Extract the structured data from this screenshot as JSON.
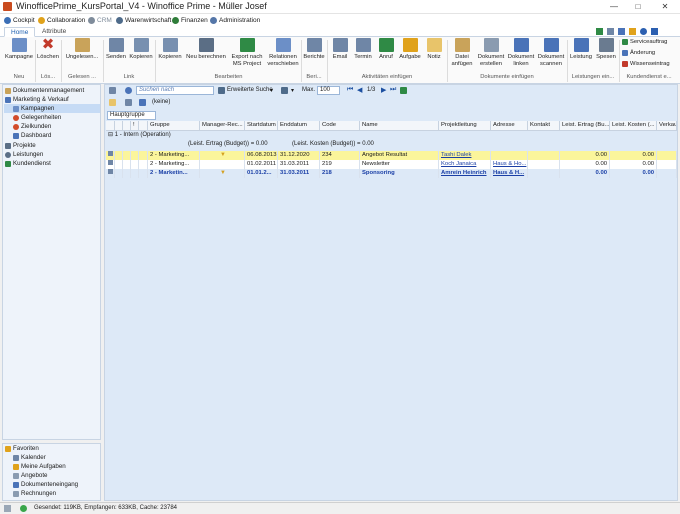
{
  "window": {
    "title": "WinofficePrime_KursPortal_V4 - Winoffice Prime - Müller Josef"
  },
  "modules": [
    {
      "label": "Cockpit",
      "color": "#3b6fb6"
    },
    {
      "label": "Collaboration",
      "color": "#e0a21b"
    },
    {
      "label": "CRM",
      "color": "#7f8c9b"
    },
    {
      "label": "Warenwirtschaft",
      "color": "#4e6b8a"
    },
    {
      "label": "Finanzen",
      "color": "#2f7d3a"
    },
    {
      "label": "Administration",
      "color": "#5576a8"
    }
  ],
  "ribbon_tabs": [
    "Home",
    "Attribute"
  ],
  "ribbon": {
    "buttons": [
      {
        "label": "Kampagne",
        "color": "#6c8fc7"
      },
      {
        "label": "Löschen",
        "color": "#c23a2b"
      },
      {
        "label": "Ungelesen...",
        "color": "#c9a35a"
      },
      {
        "label": "Senden",
        "color": "#6f86a6"
      },
      {
        "label": "Kopieren",
        "color": "#7890b0"
      },
      {
        "label": "Kopieren",
        "color": "#7890b0"
      },
      {
        "label": "Neu berechnen",
        "color": "#5b6e85"
      },
      {
        "label": "Export nach\nMS Project",
        "color": "#2f8a45"
      },
      {
        "label": "Relationen\nverschieben",
        "color": "#6c8fc7"
      },
      {
        "label": "Berichte",
        "color": "#6f86a6"
      },
      {
        "label": "Email",
        "color": "#6f86a6"
      },
      {
        "label": "Termin",
        "color": "#6f86a6"
      },
      {
        "label": "Anruf",
        "color": "#2f8a45"
      },
      {
        "label": "Aufgabe",
        "color": "#e0a21b"
      },
      {
        "label": "Notiz",
        "color": "#e8c46a"
      },
      {
        "label": "Datei\nanfügen",
        "color": "#c9a35a"
      },
      {
        "label": "Dokument\nerstellen",
        "color": "#8a9bb0"
      },
      {
        "label": "Dokument\nlinken",
        "color": "#4a73b8"
      },
      {
        "label": "Dokument\nscannen",
        "color": "#4a73b8"
      },
      {
        "label": "Leistung",
        "color": "#4a73b8"
      },
      {
        "label": "Spesen",
        "color": "#6a7b90"
      }
    ],
    "groups": [
      "Neu",
      "Lös...",
      "Gelesen ...",
      "Link",
      "Bearbeiten",
      "Beri...",
      "Aktivitäten einfügen",
      "Dokumente einfügen",
      "Leistungen ein...",
      "Kundendienst e..."
    ],
    "small_buttons": [
      "Serviceauftrag",
      "Änderung",
      "Wissenseintrag"
    ]
  },
  "nav": {
    "items": [
      {
        "label": "Dokumentenmanagement"
      },
      {
        "label": "Marketing & Verkauf"
      },
      {
        "label": "Kampagnen"
      },
      {
        "label": "Gelegenheiten"
      },
      {
        "label": "Zielkunden"
      },
      {
        "label": "Dashboard"
      },
      {
        "label": "Projekte"
      },
      {
        "label": "Leistungen"
      },
      {
        "label": "Kundendienst"
      }
    ],
    "favorites_title": "Favoriten",
    "favorites": [
      "Kalender",
      "Meine Aufgaben",
      "Angebote",
      "Dokumenteneingang",
      "Rechnungen"
    ]
  },
  "toolbar": {
    "search_placeholder": "Suchen nach",
    "advanced_search": "Erweiterte Suche",
    "max_label": "Max.",
    "max_value": "100",
    "pager": "1/3",
    "filter_value": "(keine)",
    "group_by": "Hauptgruppe"
  },
  "grid": {
    "columns": [
      "Gruppe",
      "Manager-Rec...",
      "Startdatum",
      "Enddatum",
      "Code",
      "Name",
      "Projektleitung",
      "Adresse",
      "Kontakt",
      "Leist. Ertrag (Bu...",
      "Leist. Kosten (...",
      "Verkau"
    ],
    "group_row": "1 - Intern (Operation)",
    "sum_ertrag": "(Leist. Ertrag (Budget)) = 0.00",
    "sum_kosten": "(Leist. Kosten (Budget)) = 0.00",
    "rows": [
      {
        "gruppe": "2 - Marketing...",
        "start": "06.08.2013",
        "end": "31.12.2020",
        "code": "234",
        "name": "Angebot Resultat",
        "pl": "Tashi Dalek",
        "adresse": "",
        "ertrag": "0.00",
        "kosten": "0.00",
        "highlight": "#fbf59b",
        "bold": false
      },
      {
        "gruppe": "2 - Marketing...",
        "start": "01.02.2011",
        "end": "31.03.2011",
        "code": "219",
        "name": "Newsletter",
        "pl": "Koch Janaica",
        "adresse": "Haus & Ho...",
        "ertrag": "0.00",
        "kosten": "0.00",
        "highlight": "#ffffff",
        "bold": false
      },
      {
        "gruppe": "2 - Marketin...",
        "start": "01.01.2...",
        "end": "31.03.2011",
        "code": "218",
        "name": "Sponsoring",
        "pl": "Amrein Heinrich",
        "adresse": "Haus & H...",
        "ertrag": "0.00",
        "kosten": "0.00",
        "highlight": "#dde9f7",
        "bold": true
      }
    ]
  },
  "status": {
    "text": "Gesendet: 119KB, Empfangen: 633KB, Cache: 23784"
  }
}
